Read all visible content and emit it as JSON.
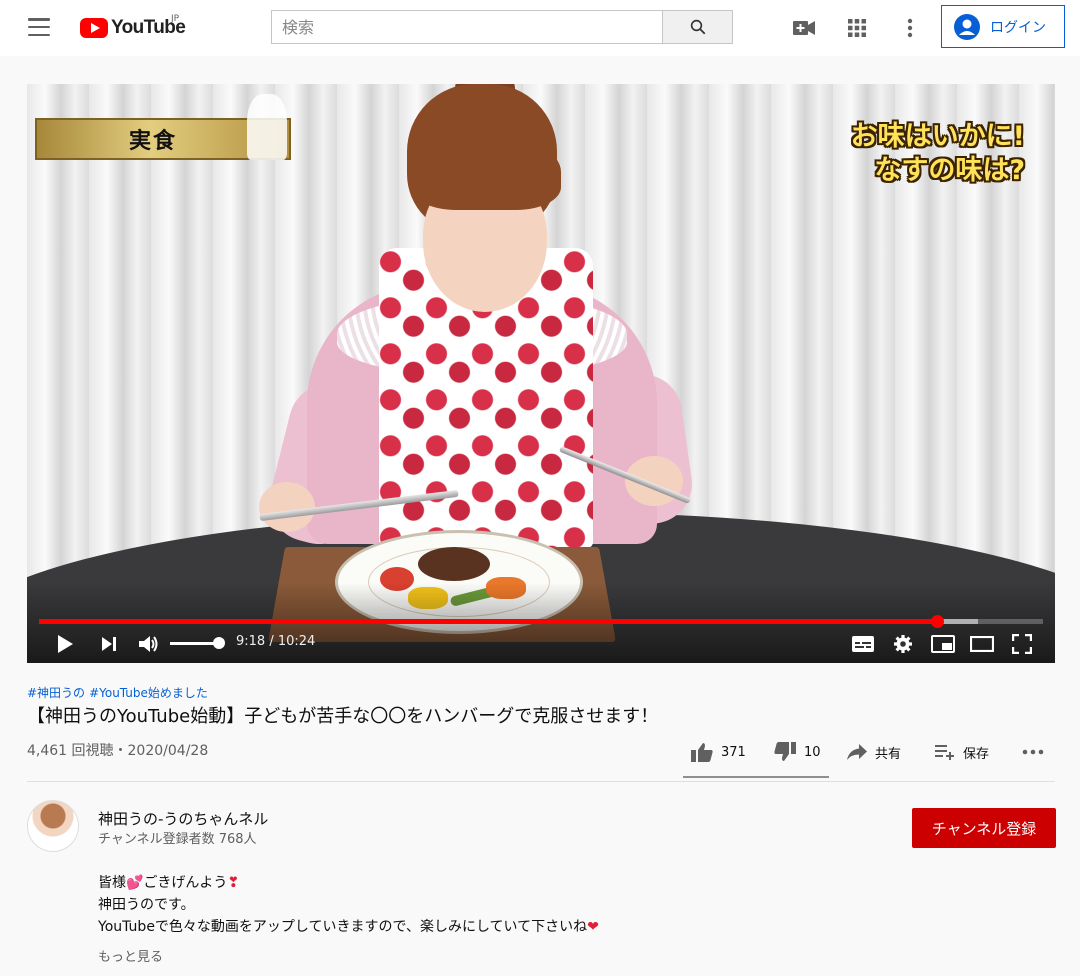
{
  "masthead": {
    "logo_text": "YouTube",
    "logo_region": "JP",
    "search_placeholder": "検索",
    "login_label": "ログイン"
  },
  "player": {
    "overlay_left": "実食",
    "overlay_right_line1": "お味はいかに!",
    "overlay_right_line2": "なすの味は?",
    "time_display": "9:18 / 10:24",
    "progress_played_fraction": 0.8942,
    "progress_buffered_fraction": 0.935,
    "volume_fraction": 0.9
  },
  "video": {
    "hashtags": [
      "#神田うの",
      "#YouTube始めました"
    ],
    "title": "【神田うのYouTube始動】子どもが苦手な〇〇をハンバーグで克服させます！",
    "views_date": "4,461 回視聴・2020/04/28",
    "likes": "371",
    "dislikes": "10",
    "share_label": "共有",
    "save_label": "保存"
  },
  "channel": {
    "name": "神田うの-うのちゃんネル",
    "subscribers": "チャンネル登録者数 768人",
    "subscribe_label": "チャンネル登録"
  },
  "description": {
    "line1_a": "皆様",
    "line1_b": "ごきげんよう",
    "line2": "神田うのです。",
    "line3": "YouTubeで色々な動画をアップしていきますので、楽しみにしていて下さいね",
    "more_label": "もっと見る"
  },
  "colors": {
    "brand_red": "#ff0000",
    "subscribe_red": "#cc0000",
    "link_blue": "#065fd4"
  }
}
